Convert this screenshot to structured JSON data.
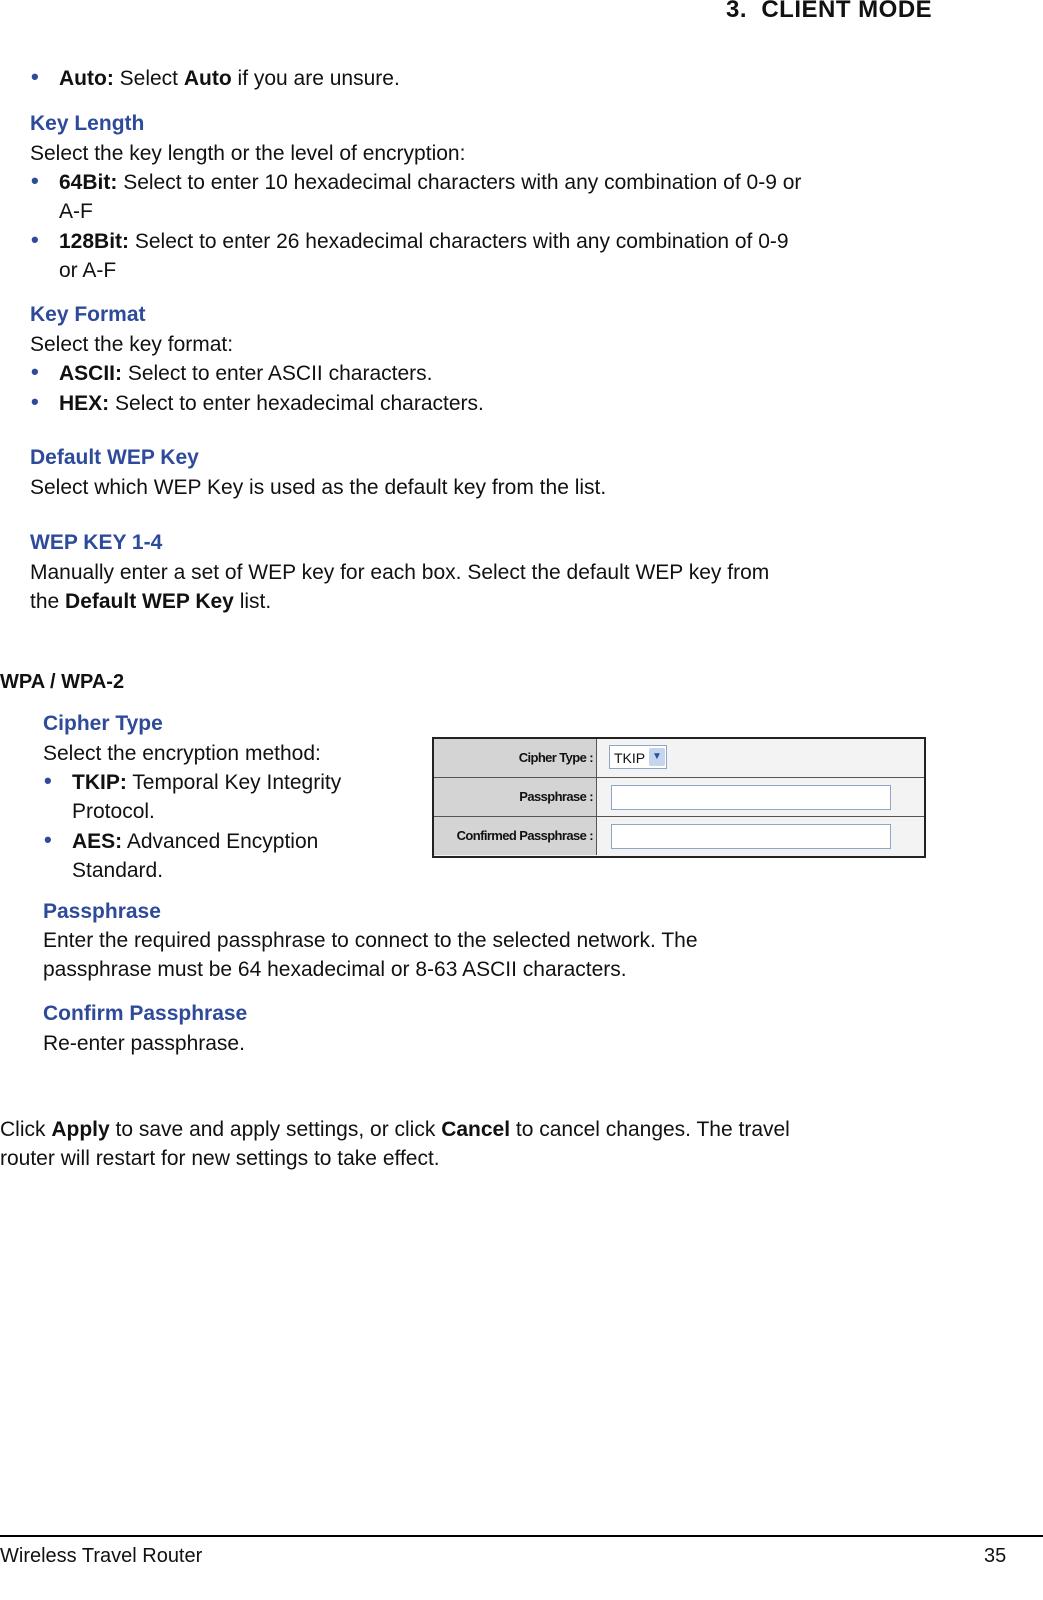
{
  "header": {
    "chapter": "3.  CLIENT MODE"
  },
  "wep": {
    "auto_bullet": {
      "bold": "Auto:",
      "pre": " Select ",
      "bold2": "Auto",
      "post": " if you are unsure."
    },
    "key_length": {
      "heading": "Key Length",
      "intro": "Select the key length or the level of encryption:",
      "items": [
        {
          "bold": "64Bit:",
          "line1": " Select to enter 10 hexadecimal characters with any combination of 0-9 or",
          "line2": "A-F"
        },
        {
          "bold": "128Bit:",
          "line1": " Select to enter 26 hexadecimal characters with any combination of 0-9",
          "line2": "or A-F"
        }
      ]
    },
    "key_format": {
      "heading": "Key Format",
      "intro": "Select the key format:",
      "items": [
        {
          "bold": "ASCII:",
          "text": " Select to enter ASCII characters."
        },
        {
          "bold": "HEX:",
          "text": " Select to enter hexadecimal characters."
        }
      ]
    },
    "default_key": {
      "heading": "Default WEP Key",
      "text": "Select which WEP Key is used as the default key from the list."
    },
    "wep_key": {
      "heading": "WEP KEY 1-4",
      "line1": "Manually enter a set of WEP key for each box. Select the default WEP key from",
      "line2_pre": "the ",
      "line2_bold": "Default WEP Key",
      "line2_post": " list."
    }
  },
  "wpa": {
    "title": "WPA / WPA-2",
    "cipher": {
      "heading": "Cipher Type",
      "intro": "Select the encryption method:",
      "items": [
        {
          "bold": "TKIP:",
          "line1": " Temporal Key Integrity",
          "line2": "Protocol."
        },
        {
          "bold": "AES:",
          "line1": " Advanced Encyption",
          "line2": "Standard."
        }
      ]
    },
    "passphrase": {
      "heading": "Passphrase",
      "line1": "Enter the required passphrase to connect to the selected network. The",
      "line2": "passphrase must be 64 hexadecimal or 8-63 ASCII characters."
    },
    "confirm": {
      "heading": "Confirm Passphrase",
      "text": "Re-enter passphrase."
    },
    "form": {
      "cipher_label": "Cipher Type :",
      "cipher_value": "TKIP",
      "passphrase_label": "Passphrase :",
      "passphrase_value": "",
      "confirmed_label": "Confirmed Passphrase :",
      "confirmed_value": ""
    }
  },
  "closing": {
    "pre": "Click ",
    "apply": "Apply",
    "mid": " to save and apply settings, or click ",
    "cancel": "Cancel",
    "post": " to cancel changes. The travel",
    "line2": "router will restart for new settings to take effect."
  },
  "footer": {
    "title": "Wireless Travel Router",
    "page": "35"
  }
}
